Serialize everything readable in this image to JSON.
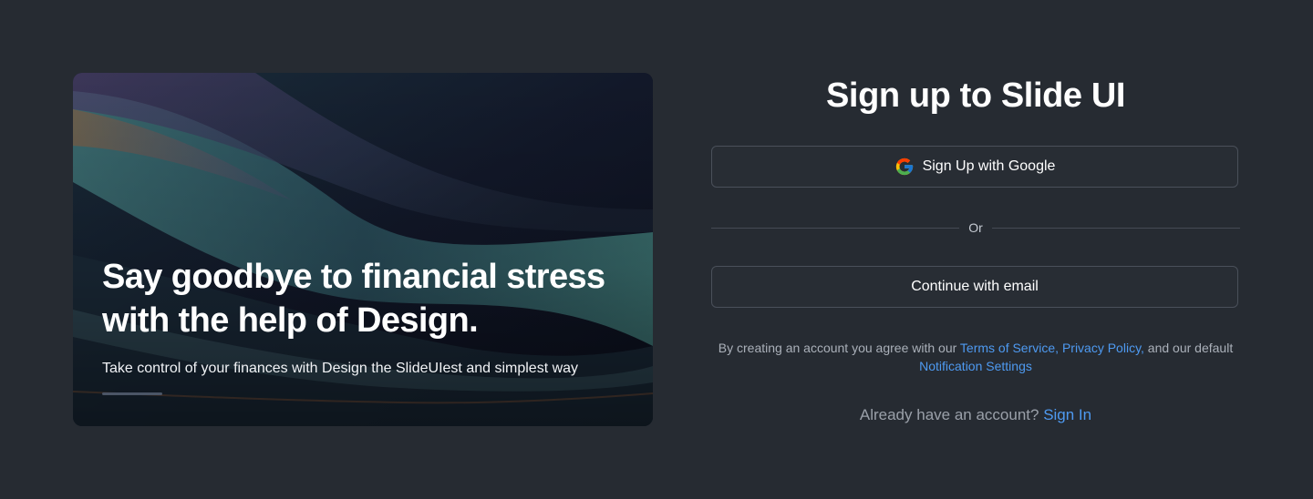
{
  "hero": {
    "title_line1": "Say goodbye to financial stress",
    "title_line2": "with the help of Design.",
    "subtitle": "Take control of your finances with Design the SlideUIest and simplest way",
    "image": "abstract-wave-background"
  },
  "form": {
    "title": "Sign up to Slide UI",
    "google_button_label": "Sign Up with Google",
    "google_icon": "google-icon",
    "divider_text": "Or",
    "email_button_label": "Continue with email",
    "terms": {
      "prefix": "By creating an account you agree with our ",
      "terms_link": "Terms of Service,",
      "privacy_link": "Privacy Policy,",
      "middle": " and our default ",
      "notification_link": "Notification Settings"
    },
    "signin": {
      "prompt": "Already have an account? ",
      "link": "Sign In"
    }
  },
  "colors": {
    "background": "#262b32",
    "link": "#4e9af1",
    "border": "#4a505a"
  }
}
